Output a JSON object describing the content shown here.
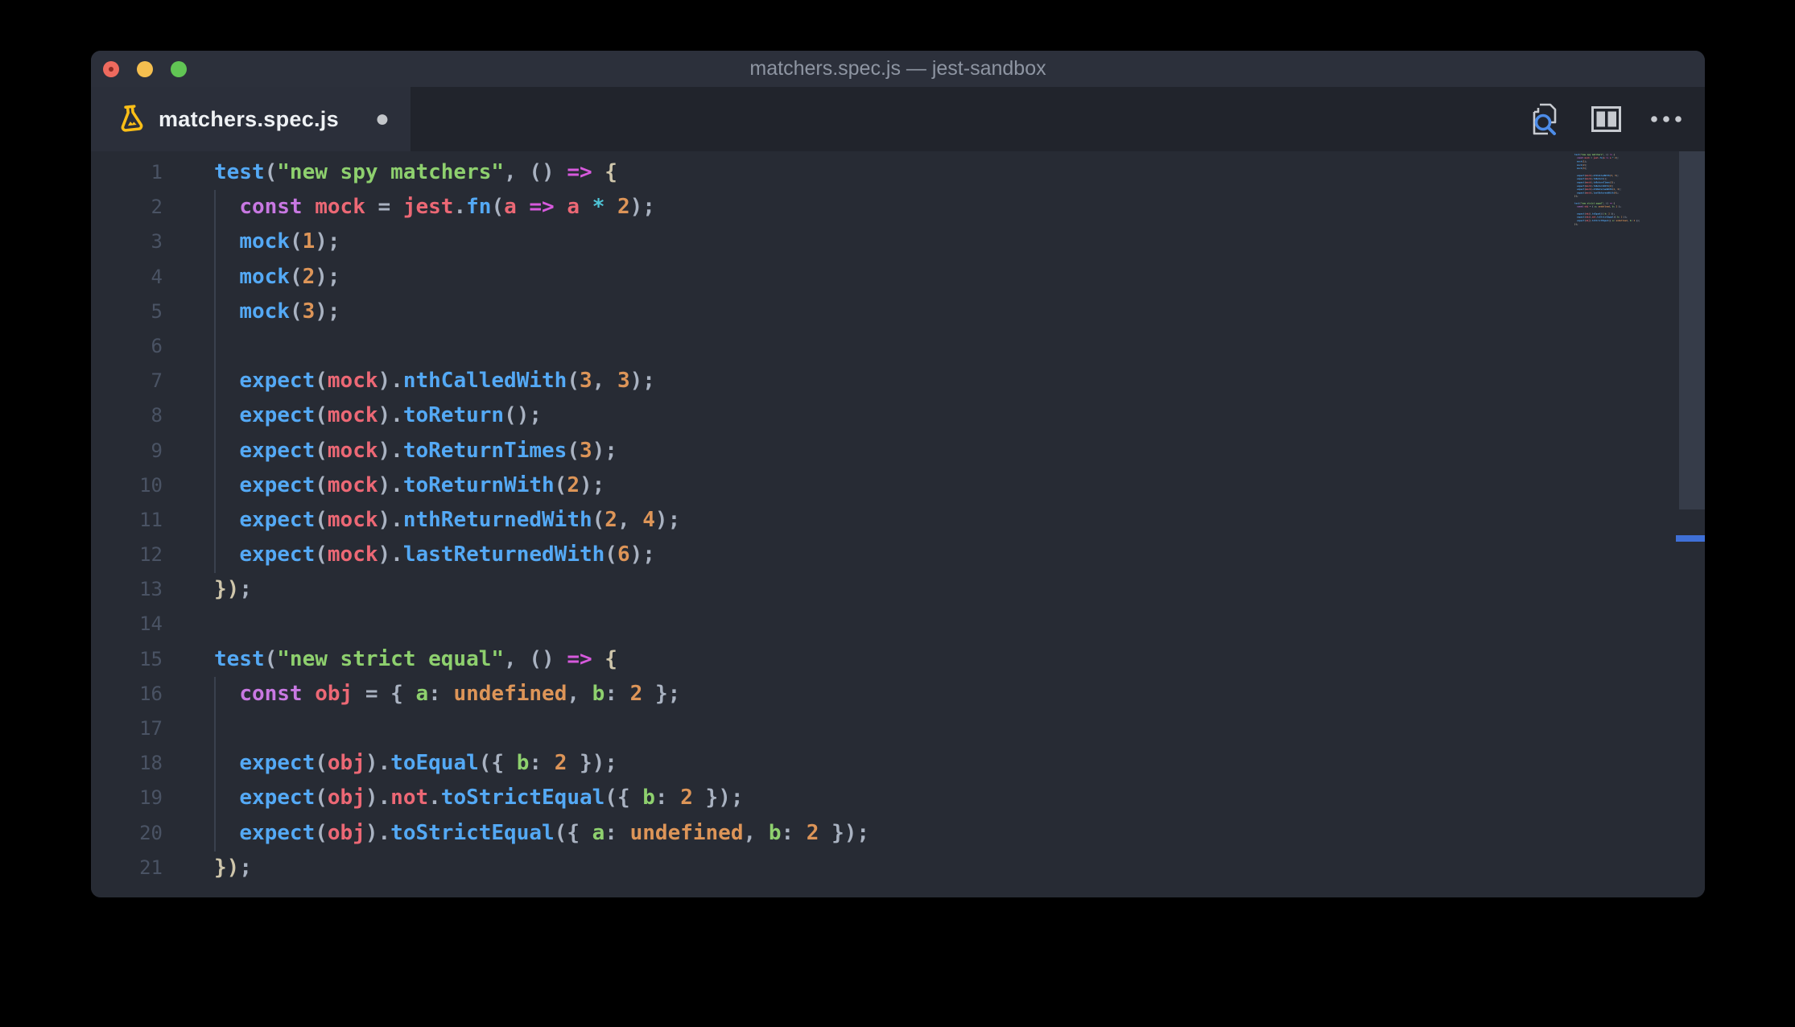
{
  "window": {
    "title": "matchers.spec.js — jest-sandbox"
  },
  "traffic_lights": [
    "close",
    "minimize",
    "zoom"
  ],
  "tab": {
    "label": "matchers.spec.js",
    "icon": "flask-test-icon",
    "modified_dot": "●"
  },
  "actions": {
    "search_editor": "search-editor-icon",
    "split_editor": "split-editor-icon",
    "more": "ellipsis-icon"
  },
  "palette": {
    "page_bg": "#000000",
    "editor_bg": "#272b34",
    "titlebar_bg": "#2c303b",
    "tabstrip_bg": "#21242c",
    "active_tab_bg": "#2b2f3a",
    "title_text": "#8e95a2",
    "tab_text": "#eef1f4",
    "line_number": "#4a5364",
    "scroll_thumb": "#363c49",
    "overview_marker_blue": "#3f70d7",
    "flask_gold": "#fcbf17",
    "icon_gray": "#c7cad0",
    "icon_blue": "#4d8ce8",
    "token_blue": "#54a9f5",
    "token_red": "#ec6875",
    "token_purple": "#c878e2",
    "token_magenta": "#d75add",
    "token_green": "#8ed06e",
    "token_orange": "#dd9558",
    "token_cyan": "#4fc4d6",
    "token_gray": "#a9b2c1",
    "token_warm": "#cfc6ab"
  },
  "editor": {
    "line_count": 21,
    "lines": [
      {
        "n": 1,
        "tokens": [
          [
            "b",
            "test"
          ],
          [
            "x",
            "("
          ],
          [
            "g",
            "\"new spy matchers\""
          ],
          [
            "x",
            ", () "
          ],
          [
            "m",
            "=>"
          ],
          [
            "x",
            " "
          ],
          [
            "w",
            "{"
          ]
        ]
      },
      {
        "n": 2,
        "tokens": [
          [
            "x",
            "  "
          ],
          [
            "p",
            "const"
          ],
          [
            "x",
            " "
          ],
          [
            "r",
            "mock"
          ],
          [
            "x",
            " = "
          ],
          [
            "r",
            "jest"
          ],
          [
            "x",
            "."
          ],
          [
            "b",
            "fn"
          ],
          [
            "x",
            "("
          ],
          [
            "r",
            "a"
          ],
          [
            "x",
            " "
          ],
          [
            "m",
            "=>"
          ],
          [
            "x",
            " "
          ],
          [
            "r",
            "a"
          ],
          [
            "x",
            " "
          ],
          [
            "c",
            "*"
          ],
          [
            "x",
            " "
          ],
          [
            "o",
            "2"
          ],
          [
            "x",
            ");"
          ]
        ]
      },
      {
        "n": 3,
        "tokens": [
          [
            "x",
            "  "
          ],
          [
            "b",
            "mock"
          ],
          [
            "x",
            "("
          ],
          [
            "o",
            "1"
          ],
          [
            "x",
            ");"
          ]
        ]
      },
      {
        "n": 4,
        "tokens": [
          [
            "x",
            "  "
          ],
          [
            "b",
            "mock"
          ],
          [
            "x",
            "("
          ],
          [
            "o",
            "2"
          ],
          [
            "x",
            ");"
          ]
        ]
      },
      {
        "n": 5,
        "tokens": [
          [
            "x",
            "  "
          ],
          [
            "b",
            "mock"
          ],
          [
            "x",
            "("
          ],
          [
            "o",
            "3"
          ],
          [
            "x",
            ");"
          ]
        ]
      },
      {
        "n": 6,
        "tokens": []
      },
      {
        "n": 7,
        "tokens": [
          [
            "x",
            "  "
          ],
          [
            "b",
            "expect"
          ],
          [
            "x",
            "("
          ],
          [
            "r",
            "mock"
          ],
          [
            "x",
            ")."
          ],
          [
            "b",
            "nthCalledWith"
          ],
          [
            "x",
            "("
          ],
          [
            "o",
            "3"
          ],
          [
            "x",
            ", "
          ],
          [
            "o",
            "3"
          ],
          [
            "x",
            ");"
          ]
        ]
      },
      {
        "n": 8,
        "tokens": [
          [
            "x",
            "  "
          ],
          [
            "b",
            "expect"
          ],
          [
            "x",
            "("
          ],
          [
            "r",
            "mock"
          ],
          [
            "x",
            ")."
          ],
          [
            "b",
            "toReturn"
          ],
          [
            "x",
            "();"
          ]
        ]
      },
      {
        "n": 9,
        "tokens": [
          [
            "x",
            "  "
          ],
          [
            "b",
            "expect"
          ],
          [
            "x",
            "("
          ],
          [
            "r",
            "mock"
          ],
          [
            "x",
            ")."
          ],
          [
            "b",
            "toReturnTimes"
          ],
          [
            "x",
            "("
          ],
          [
            "o",
            "3"
          ],
          [
            "x",
            ");"
          ]
        ]
      },
      {
        "n": 10,
        "tokens": [
          [
            "x",
            "  "
          ],
          [
            "b",
            "expect"
          ],
          [
            "x",
            "("
          ],
          [
            "r",
            "mock"
          ],
          [
            "x",
            ")."
          ],
          [
            "b",
            "toReturnWith"
          ],
          [
            "x",
            "("
          ],
          [
            "o",
            "2"
          ],
          [
            "x",
            ");"
          ]
        ]
      },
      {
        "n": 11,
        "tokens": [
          [
            "x",
            "  "
          ],
          [
            "b",
            "expect"
          ],
          [
            "x",
            "("
          ],
          [
            "r",
            "mock"
          ],
          [
            "x",
            ")."
          ],
          [
            "b",
            "nthReturnedWith"
          ],
          [
            "x",
            "("
          ],
          [
            "o",
            "2"
          ],
          [
            "x",
            ", "
          ],
          [
            "o",
            "4"
          ],
          [
            "x",
            ");"
          ]
        ]
      },
      {
        "n": 12,
        "tokens": [
          [
            "x",
            "  "
          ],
          [
            "b",
            "expect"
          ],
          [
            "x",
            "("
          ],
          [
            "r",
            "mock"
          ],
          [
            "x",
            ")."
          ],
          [
            "b",
            "lastReturnedWith"
          ],
          [
            "x",
            "("
          ],
          [
            "o",
            "6"
          ],
          [
            "x",
            ");"
          ]
        ]
      },
      {
        "n": 13,
        "tokens": [
          [
            "w",
            "})"
          ],
          [
            "x",
            ";"
          ]
        ]
      },
      {
        "n": 14,
        "tokens": []
      },
      {
        "n": 15,
        "tokens": [
          [
            "b",
            "test"
          ],
          [
            "x",
            "("
          ],
          [
            "g",
            "\"new strict equal\""
          ],
          [
            "x",
            ", () "
          ],
          [
            "m",
            "=>"
          ],
          [
            "x",
            " "
          ],
          [
            "w",
            "{"
          ]
        ]
      },
      {
        "n": 16,
        "tokens": [
          [
            "x",
            "  "
          ],
          [
            "p",
            "const"
          ],
          [
            "x",
            " "
          ],
          [
            "r",
            "obj"
          ],
          [
            "x",
            " = { "
          ],
          [
            "g",
            "a"
          ],
          [
            "x",
            ": "
          ],
          [
            "o",
            "undefined"
          ],
          [
            "x",
            ", "
          ],
          [
            "g",
            "b"
          ],
          [
            "x",
            ": "
          ],
          [
            "o",
            "2"
          ],
          [
            "x",
            " };"
          ]
        ]
      },
      {
        "n": 17,
        "tokens": []
      },
      {
        "n": 18,
        "tokens": [
          [
            "x",
            "  "
          ],
          [
            "b",
            "expect"
          ],
          [
            "x",
            "("
          ],
          [
            "r",
            "obj"
          ],
          [
            "x",
            ")."
          ],
          [
            "b",
            "toEqual"
          ],
          [
            "x",
            "({ "
          ],
          [
            "g",
            "b"
          ],
          [
            "x",
            ": "
          ],
          [
            "o",
            "2"
          ],
          [
            "x",
            " });"
          ]
        ]
      },
      {
        "n": 19,
        "tokens": [
          [
            "x",
            "  "
          ],
          [
            "b",
            "expect"
          ],
          [
            "x",
            "("
          ],
          [
            "r",
            "obj"
          ],
          [
            "x",
            ")."
          ],
          [
            "r",
            "not"
          ],
          [
            "x",
            "."
          ],
          [
            "b",
            "toStrictEqual"
          ],
          [
            "x",
            "({ "
          ],
          [
            "g",
            "b"
          ],
          [
            "x",
            ": "
          ],
          [
            "o",
            "2"
          ],
          [
            "x",
            " });"
          ]
        ]
      },
      {
        "n": 20,
        "tokens": [
          [
            "x",
            "  "
          ],
          [
            "b",
            "expect"
          ],
          [
            "x",
            "("
          ],
          [
            "r",
            "obj"
          ],
          [
            "x",
            ")."
          ],
          [
            "b",
            "toStrictEqual"
          ],
          [
            "x",
            "({ "
          ],
          [
            "g",
            "a"
          ],
          [
            "x",
            ": "
          ],
          [
            "o",
            "undefined"
          ],
          [
            "x",
            ", "
          ],
          [
            "g",
            "b"
          ],
          [
            "x",
            ": "
          ],
          [
            "o",
            "2"
          ],
          [
            "x",
            " });"
          ]
        ]
      },
      {
        "n": 21,
        "tokens": [
          [
            "w",
            "})"
          ],
          [
            "x",
            ";"
          ]
        ]
      }
    ]
  }
}
